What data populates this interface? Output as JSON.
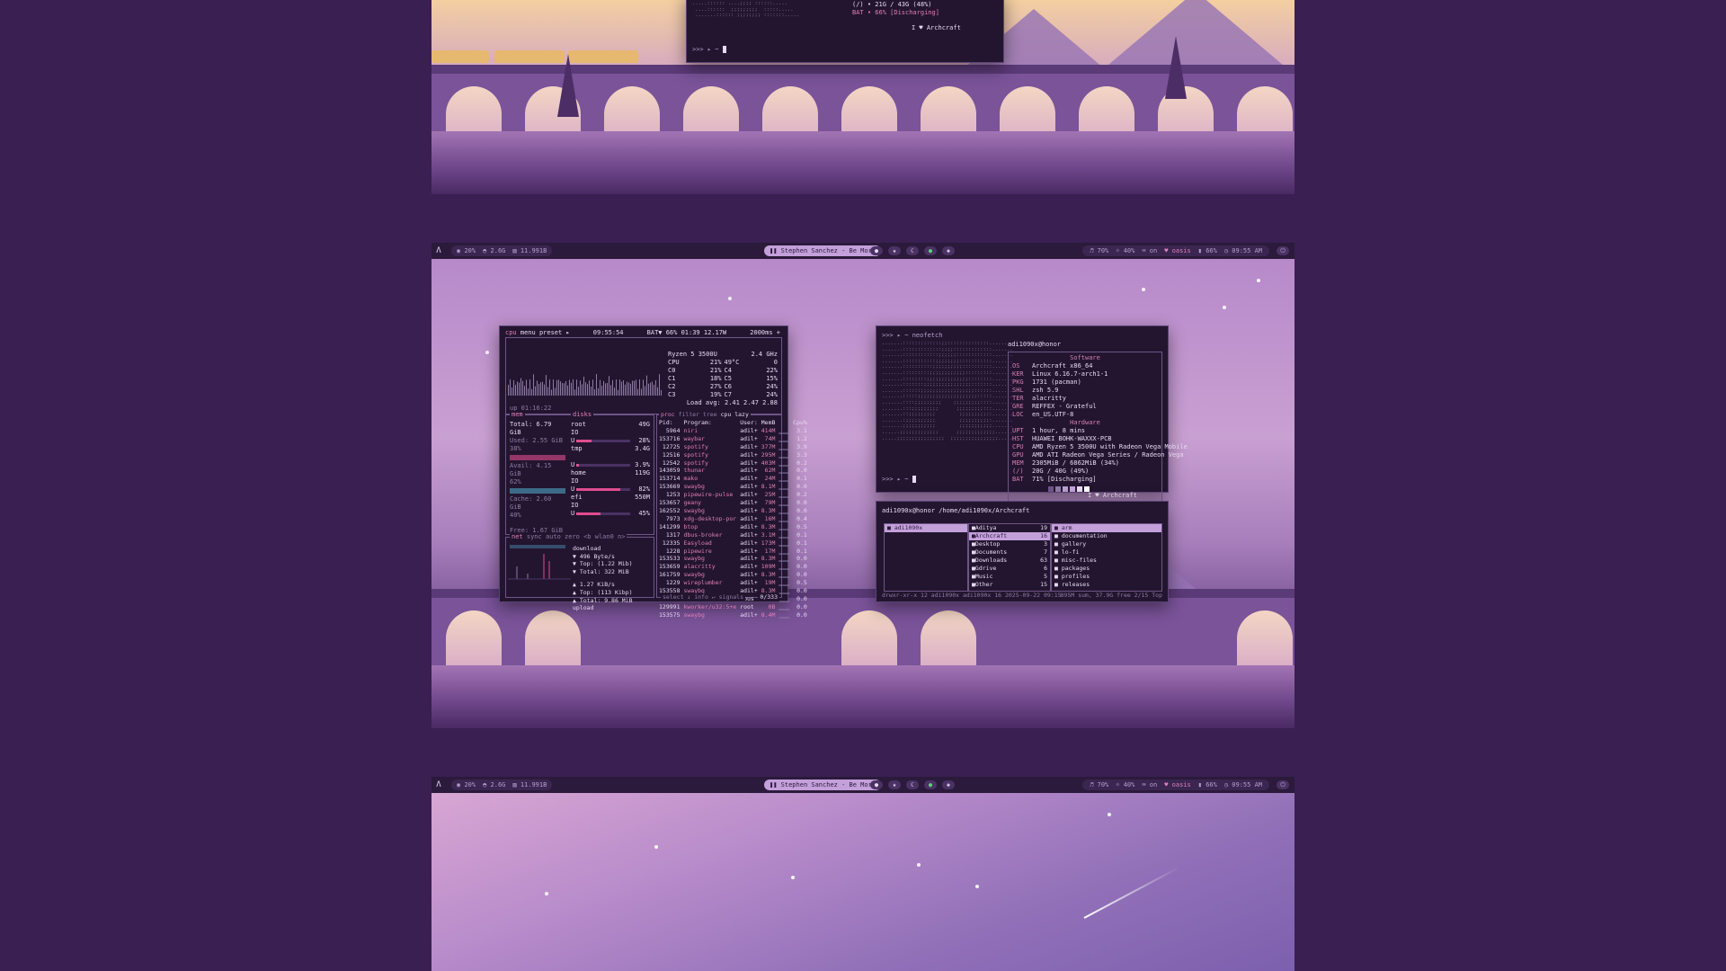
{
  "topbar": {
    "cpu": "20%",
    "temp": "2.6G",
    "disk": "11.991B",
    "media": "Stephen Sanchez - Be More",
    "volume": "70%",
    "brightness": "40%",
    "kbd": "on",
    "wifi": "oasis",
    "battery": "66%",
    "clock": "09:55 AM"
  },
  "workspace_top": {
    "sysinfo_tail": [
      "(/)  • 21G / 43G (48%)",
      "BAT  • 66% [Discharging]"
    ],
    "love_line": "I ♥ Archcraft",
    "prompt": ">>> ▸ ~"
  },
  "btop": {
    "header": {
      "cpu_tab": "cpu",
      "menu": "menu",
      "preset": "preset ▸",
      "time": "09:55:54",
      "bat": "BAT▼ 66% 01:39 12.17W",
      "interval": "2000ms +"
    },
    "cpu_model": "Ryzen 5 3500U",
    "cpu_freq": "2.4 GHz",
    "cores": [
      [
        "CPU",
        "21%",
        "49°C",
        "0"
      ],
      [
        "C0",
        "21%",
        "C4",
        "22%"
      ],
      [
        "C1",
        "18%",
        "C5",
        "15%"
      ],
      [
        "C2",
        "27%",
        "C6",
        "24%"
      ],
      [
        "C3",
        "19%",
        "C7",
        "24%"
      ]
    ],
    "load_avg": "Load avg:  2.41  2.47  2.88",
    "uptime": "up 01:16:22",
    "mem": {
      "title": "mem",
      "total": "Total:   6.79 GiB",
      "used": "Used:    2.55 GiB",
      "used_pct": "38%",
      "avail": "Avail:   4.15 GiB",
      "avail_pct": "62%",
      "cache": "Cache:   2.60 GiB",
      "cache_pct": "40%",
      "free": "Free:    1.67 GiB",
      "free_pct": "25%"
    },
    "disks": {
      "title": "disks",
      "items": [
        {
          "name": "root",
          "size": "49G",
          "io": "IO",
          "u": "28%",
          "fill": 0.28
        },
        {
          "name": "tmp",
          "size": "3.4G",
          "io": "",
          "u": "3.9%",
          "fill": 0.04
        },
        {
          "name": "home",
          "size": "119G",
          "io": "IO",
          "u": "82%",
          "fill": 0.82
        },
        {
          "name": "efi",
          "size": "550M",
          "io": "IO",
          "u": "45%",
          "fill": 0.45
        }
      ]
    },
    "net": {
      "title": "net",
      "tabs": "sync  auto  zero  <b wlan0 n>",
      "download": "download",
      "dl_rate": "▼ 496 Byte/s",
      "dl_top": "▼ Top:   (1.22 Mib)",
      "dl_total": "▼ Total:    322 MiB",
      "ul_rate": "▲ 1.27 KiB/s",
      "ul_top": "▲ Top:   (113 Kibp)",
      "ul_total": "▲ Total:  9.86 MiB",
      "upload": "upload"
    },
    "proc": {
      "title": "proc",
      "filter": "filter",
      "tree": "tree",
      "cpu_lazy": "cpu lazy",
      "headers": [
        "Pid:",
        "Program:",
        "User:",
        "MemB",
        "",
        "Cpu%"
      ],
      "rows": [
        [
          "5964",
          "niri",
          "adil+",
          "414M",
          "3.1"
        ],
        [
          "153716",
          "waybar",
          "adil+",
          "74M",
          "1.2"
        ],
        [
          "12725",
          "spotify",
          "adil+",
          "377M",
          "3.9"
        ],
        [
          "12516",
          "spotify",
          "adil+",
          "295M",
          "3.3"
        ],
        [
          "12542",
          "spotify",
          "adil+",
          "403M",
          "0.2"
        ],
        [
          "143059",
          "thunar",
          "adil+",
          "62M",
          "0.0"
        ],
        [
          "153714",
          "mako",
          "adil+",
          "24M",
          "0.1"
        ],
        [
          "153669",
          "swaybg",
          "adil+",
          "8.1M",
          "0.0"
        ],
        [
          "1253",
          "pipewire-pulse",
          "adil+",
          "25M",
          "0.2"
        ],
        [
          "153657",
          "geany",
          "adil+",
          "79M",
          "0.0"
        ],
        [
          "162552",
          "swaybg",
          "adil+",
          "8.3M",
          "0.0"
        ],
        [
          "7973",
          "xdg-desktop-por",
          "adil+",
          "16M",
          "0.4"
        ],
        [
          "141299",
          "btop",
          "adil+",
          "8.3M",
          "0.5"
        ],
        [
          "1317",
          "dbus-broker",
          "adil+",
          "3.1M",
          "0.1"
        ],
        [
          "12335",
          "Easyload",
          "adil+",
          "173M",
          "0.1"
        ],
        [
          "1228",
          "pipewire",
          "adil+",
          "17M",
          "0.1"
        ],
        [
          "153533",
          "swaybg",
          "adil+",
          "8.3M",
          "0.0"
        ],
        [
          "153659",
          "alacritty",
          "adil+",
          "109M",
          "0.0"
        ],
        [
          "161759",
          "swaybg",
          "adil+",
          "8.3M",
          "0.0"
        ],
        [
          "1229",
          "wireplumber",
          "adil+",
          "19M",
          "0.5"
        ],
        [
          "153558",
          "swaybg",
          "adil+",
          "8.3M",
          "0.0"
        ],
        [
          "531",
          "dbus-broker",
          "dbus",
          "3.9M",
          "0.0"
        ],
        [
          "129991",
          "kworker/u32:5+e",
          "root",
          "0B",
          "0.0"
        ],
        [
          "153575",
          "swaybg",
          "adil+",
          "8.4M",
          "0.0"
        ]
      ],
      "footer": "select ↓ info ↵ signals",
      "count": "0/333"
    }
  },
  "neofetch": {
    "command": ">>> ▸ ~ neofetch",
    "user": "adi1090x@honor",
    "software_title": "Software",
    "software": [
      [
        "OS",
        "Archcraft x86_64"
      ],
      [
        "KER",
        "Linux 6.16.7-arch1-1"
      ],
      [
        "PKG",
        "1731 (pacman)"
      ],
      [
        "SHL",
        "zsh 5.9"
      ],
      [
        "TER",
        "alacritty"
      ],
      [
        "GRE",
        "REFFEX - Grateful"
      ],
      [
        "LOC",
        "en_US.UTF-8"
      ]
    ],
    "hardware_title": "Hardware",
    "hardware": [
      [
        "UPT",
        "1 hour, 8 mins"
      ],
      [
        "HST",
        "HUAWEI BOHK-WAXXX-PCB"
      ],
      [
        "CPU",
        "AMD Ryzen 5 3500U with Radeon Vega Mobile"
      ],
      [
        "GPU",
        "AMD ATI Radeon Vega Series / Radeon Vega"
      ],
      [
        "MEM",
        "2305MiB / 6862MiB (34%)"
      ],
      [
        "(/)",
        "20G / 40G (49%)"
      ],
      [
        "BAT",
        "71% [Discharging]"
      ]
    ],
    "love_line": "I ♥ Archcraft",
    "prompt": ">>> ▸ ~"
  },
  "filemanager": {
    "path": "adi1090x@honor /home/adi1090x/Archcraft",
    "col1": [
      "adi1090x"
    ],
    "col2": [
      [
        "Aditya",
        "19"
      ],
      [
        "Archcraft",
        "16"
      ],
      [
        "Desktop",
        "3"
      ],
      [
        "Documents",
        "7"
      ],
      [
        "Downloads",
        "63"
      ],
      [
        "Gdrive",
        "6"
      ],
      [
        "Music",
        "5"
      ],
      [
        "Other",
        "15"
      ]
    ],
    "col3": [
      "arm",
      "documentation",
      "gallery",
      "lo-fi",
      "misc-files",
      "packages",
      "profiles",
      "releases"
    ],
    "status_left": "drwxr-xr-x 12 adi1090x adi1090x 16 2025-09-22 09:15",
    "status_right": "895M sum, 37.9G free  2/15  Top"
  },
  "colors": {
    "bar_bg": "#2b1a3b",
    "accent_pink": "#e04c8f",
    "accent_lilac": "#c4a0db",
    "term_bg": "#23152f"
  }
}
